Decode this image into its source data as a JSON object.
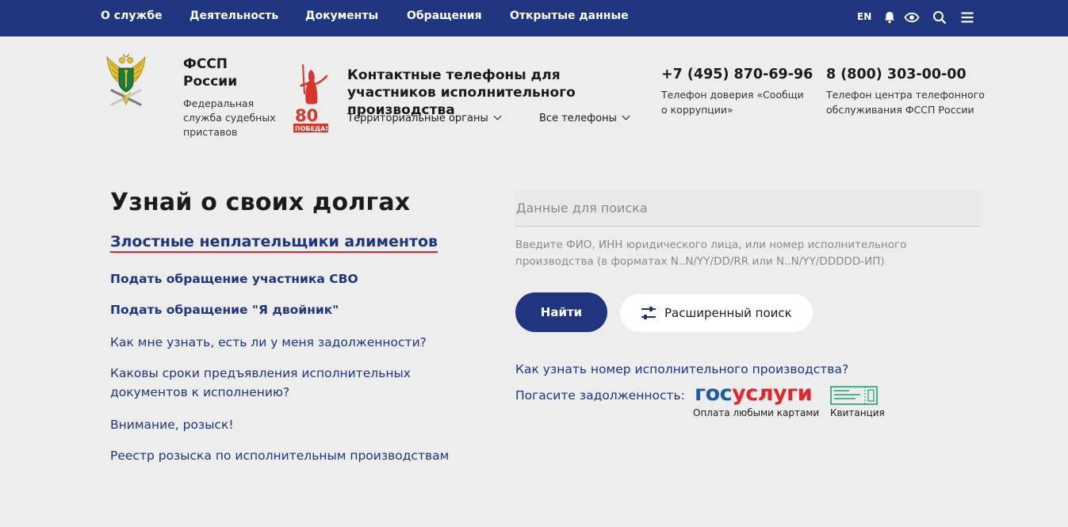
{
  "topnav": {
    "items": [
      "О службе",
      "Деятельность",
      "Документы",
      "Обращения",
      "Открытые данные"
    ],
    "lang": "EN",
    "icons": [
      "bell-icon",
      "eye-icon",
      "search-icon",
      "menu-icon"
    ]
  },
  "header": {
    "org_name": "ФССП\nРоссии",
    "org_sub": "Федеральная\nслужба судебных\nприставов",
    "contacts_title": "Контактные телефоны для участников исполнительного производства",
    "dropdowns": [
      "Территориальные органы",
      "Все телефоны"
    ],
    "phones": [
      {
        "number": "+7 (495) 870-69-96",
        "caption": "Телефон доверия «Сообщи о коррупции»"
      },
      {
        "number": "8 (800) 303-00-00",
        "caption": "Телефон центра телефонного обслуживания ФССП России"
      }
    ],
    "victory_text": "80 ПОБЕДА!"
  },
  "main": {
    "title": "Узнай о своих долгах",
    "hero_link": "Злостные неплательщики алиментов",
    "links": [
      {
        "label": "Подать обращение участника СВО",
        "bold": true
      },
      {
        "label": "Подать обращение \"Я двойник\"",
        "bold": true
      },
      {
        "label": "Как мне узнать, есть ли у меня задолженности?",
        "bold": false
      },
      {
        "label": "Каковы сроки предъявления исполнительных документов к исполнению?",
        "bold": false
      },
      {
        "label": "Внимание, розыск!",
        "bold": false
      },
      {
        "label": "Реестр розыска по исполнительным производствам",
        "bold": false
      }
    ]
  },
  "search": {
    "placeholder": "Данные для поиска",
    "value": "",
    "hint": "Введите ФИО, ИНН юридического лица, или номер исполнительного производства (в форматах N..N/YY/DD/RR или N..N/YY/DDDDD-ИП)",
    "find_label": "Найти",
    "advanced_label": "Расширенный поиск",
    "how_link": "Как узнать номер исполнительного производства?",
    "pay_label": "Погасите задолженность:",
    "gos_blue": "гос",
    "gos_red": "услуги",
    "gos_caption": "Оплата любыми картами",
    "kv_caption": "Квитанция"
  },
  "colors": {
    "brand": "#1f3580",
    "accent_red": "#e0262a",
    "gos_blue": "#1f5ca8",
    "receipt_green": "#1aa36a"
  }
}
